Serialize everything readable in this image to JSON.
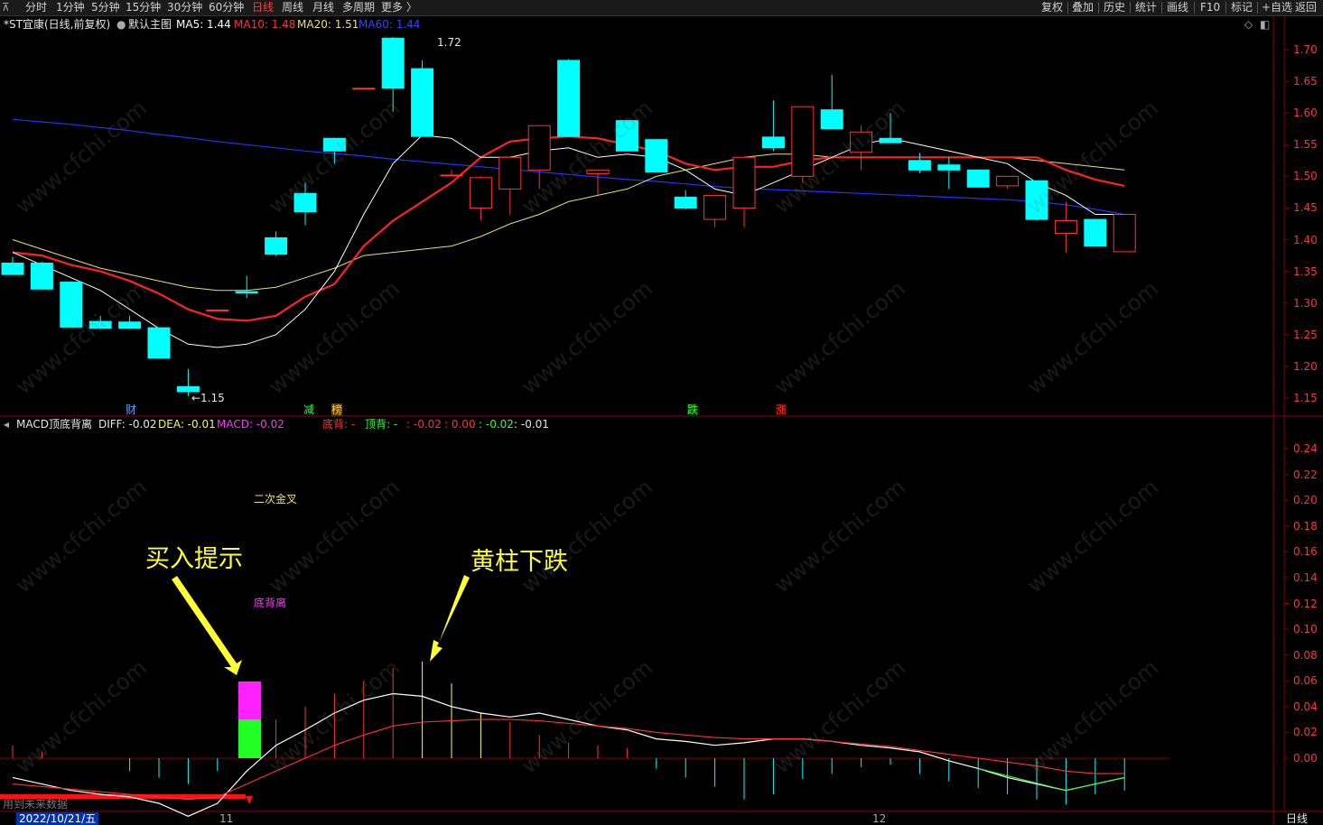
{
  "topbar": {
    "back_icon": "⊼",
    "periods": [
      "分时",
      "1分钟",
      "5分钟",
      "15分钟",
      "30分钟",
      "60分钟",
      "日线",
      "周线",
      "月线",
      "多周期",
      "更多 〉"
    ],
    "active_period": "日线",
    "right_buttons": [
      "复权",
      "叠加",
      "历史",
      "统计",
      "画线",
      "F10",
      "标记",
      "+自选",
      "返回"
    ]
  },
  "main_header": {
    "stock": "*ST宜康(日线,前复权)",
    "template": "默认主图",
    "ma5": "MA5: 1.44",
    "ma10": "MA10: 1.48",
    "ma20": "MA20: 1.51",
    "ma60": "MA60: 1.44",
    "diamond_icon": "◇",
    "more_icon": "◧"
  },
  "main_axis": [
    "1.70",
    "1.65",
    "1.60",
    "1.55",
    "1.50",
    "1.45",
    "1.40",
    "1.35",
    "1.30",
    "1.25",
    "1.20",
    "1.15"
  ],
  "main_notes": {
    "high": "1.72",
    "low": "←1.15",
    "flags": [
      "财",
      "减",
      "榜",
      "跌",
      "涨"
    ]
  },
  "macd_header": {
    "name": "MACD顶底背离",
    "diff": "DIFF: -0.02",
    "dea": "DEA: -0.01",
    "macd": "MACD: -0.02",
    "bottom_div": "底背: -",
    "top_div": "顶背: -",
    "v1": ": -0.02",
    "v2": ": 0.00",
    "v3": ": -0.02",
    "v4": ": -0.01"
  },
  "macd_axis": [
    "0.24",
    "0.22",
    "0.20",
    "0.18",
    "0.16",
    "0.14",
    "0.12",
    "0.10",
    "0.08",
    "0.06",
    "0.04",
    "0.02",
    "0.00"
  ],
  "annotations": {
    "golden_cross": "二次金叉",
    "buy_hint": "买入提示",
    "bottom_divergence": "底背离",
    "yellow_drop": "黄柱下跌"
  },
  "footer": {
    "future_data": "用到未来数据",
    "date": "2022/10/21/五",
    "month_11": "11",
    "month_12": "12",
    "period_tab": "日线"
  },
  "watermark": "www.cfchi.com",
  "colors": {
    "up": "#ff3333",
    "down": "#00ffff",
    "ma5": "#ffffff",
    "ma10": "#ff2222",
    "ma20": "#e8e070",
    "ma60": "#2233ff",
    "grid": "#8b0000"
  },
  "chart_data": {
    "type": "candlestick",
    "ohlc": [
      [
        1.363,
        1.373,
        1.353,
        1.345
      ],
      [
        1.363,
        1.365,
        1.33,
        1.322
      ],
      [
        1.333,
        1.334,
        1.285,
        1.262
      ],
      [
        1.271,
        1.28,
        1.26,
        1.26
      ],
      [
        1.27,
        1.28,
        1.262,
        1.26
      ],
      [
        1.261,
        1.261,
        1.213,
        1.213
      ],
      [
        1.168,
        1.196,
        1.153,
        1.16
      ],
      [
        1.289,
        1.29,
        1.289,
        1.289
      ],
      [
        1.318,
        1.343,
        1.308,
        1.316
      ],
      [
        1.403,
        1.413,
        1.374,
        1.377
      ],
      [
        1.473,
        1.49,
        1.423,
        1.444
      ],
      [
        1.56,
        1.561,
        1.52,
        1.54
      ],
      [
        1.639,
        1.64,
        1.639,
        1.639
      ],
      [
        1.718,
        1.72,
        1.602,
        1.639
      ],
      [
        1.67,
        1.683,
        1.563,
        1.563
      ],
      [
        1.502,
        1.51,
        1.502,
        1.502
      ],
      [
        1.45,
        1.5,
        1.43,
        1.498
      ],
      [
        1.48,
        1.53,
        1.44,
        1.53
      ],
      [
        1.51,
        1.58,
        1.48,
        1.58
      ],
      [
        1.683,
        1.685,
        1.563,
        1.563
      ],
      [
        1.504,
        1.51,
        1.471,
        1.51
      ],
      [
        1.588,
        1.588,
        1.543,
        1.54
      ],
      [
        1.558,
        1.558,
        1.51,
        1.507
      ],
      [
        1.467,
        1.478,
        1.448,
        1.45
      ],
      [
        1.432,
        1.47,
        1.42,
        1.47
      ],
      [
        1.45,
        1.53,
        1.42,
        1.53
      ],
      [
        1.562,
        1.62,
        1.54,
        1.545
      ],
      [
        1.5,
        1.61,
        1.49,
        1.61
      ],
      [
        1.605,
        1.66,
        1.575,
        1.575
      ],
      [
        1.538,
        1.58,
        1.51,
        1.57
      ],
      [
        1.56,
        1.6,
        1.553,
        1.553
      ],
      [
        1.525,
        1.537,
        1.505,
        1.51
      ],
      [
        1.518,
        1.53,
        1.48,
        1.51
      ],
      [
        1.51,
        1.51,
        1.483,
        1.483
      ],
      [
        1.485,
        1.5,
        1.48,
        1.5
      ],
      [
        1.493,
        1.493,
        1.43,
        1.432
      ],
      [
        1.41,
        1.46,
        1.38,
        1.43
      ],
      [
        1.432,
        1.432,
        1.39,
        1.39
      ],
      [
        1.381,
        1.44,
        1.381,
        1.44
      ]
    ],
    "ma5": [
      1.38,
      1.36,
      1.34,
      1.32,
      1.29,
      1.26,
      1.235,
      1.23,
      1.235,
      1.25,
      1.29,
      1.35,
      1.44,
      1.52,
      1.565,
      1.56,
      1.53,
      1.53,
      1.54,
      1.545,
      1.53,
      1.535,
      1.53,
      1.51,
      1.48,
      1.47,
      1.49,
      1.51,
      1.53,
      1.55,
      1.56,
      1.55,
      1.54,
      1.53,
      1.52,
      1.49,
      1.47,
      1.44,
      1.44
    ],
    "ma10": [
      1.38,
      1.375,
      1.36,
      1.35,
      1.335,
      1.315,
      1.29,
      1.275,
      1.272,
      1.28,
      1.31,
      1.33,
      1.39,
      1.43,
      1.46,
      1.49,
      1.53,
      1.555,
      1.56,
      1.563,
      1.56,
      1.55,
      1.54,
      1.52,
      1.51,
      1.515,
      1.515,
      1.525,
      1.53,
      1.53,
      1.53,
      1.53,
      1.53,
      1.53,
      1.53,
      1.53,
      1.51,
      1.495,
      1.485
    ],
    "ma20": [
      1.4,
      1.385,
      1.37,
      1.355,
      1.345,
      1.335,
      1.325,
      1.32,
      1.32,
      1.325,
      1.34,
      1.355,
      1.375,
      1.38,
      1.385,
      1.39,
      1.405,
      1.425,
      1.44,
      1.46,
      1.47,
      1.48,
      1.5,
      1.51,
      1.52,
      1.53,
      1.535,
      1.535,
      1.53,
      1.53,
      1.53,
      1.53,
      1.53,
      1.53,
      1.53,
      1.525,
      1.52,
      1.515,
      1.51
    ],
    "ma60": [
      1.59,
      1.586,
      1.582,
      1.577,
      1.572,
      1.566,
      1.561,
      1.555,
      1.55,
      1.545,
      1.54,
      1.536,
      1.532,
      1.527,
      1.523,
      1.519,
      1.515,
      1.511,
      1.507,
      1.503,
      1.499,
      1.495,
      1.492,
      1.488,
      1.484,
      1.481,
      1.479,
      1.477,
      1.475,
      1.473,
      1.471,
      1.469,
      1.467,
      1.465,
      1.463,
      1.46,
      1.455,
      1.448,
      1.44
    ],
    "macd_bars": [
      0.01,
      0.005,
      0.0,
      0.0,
      -0.01,
      -0.015,
      -0.02,
      -0.01,
      0.04,
      0.03,
      0.04,
      0.05,
      0.06,
      0.07,
      0.075,
      0.058,
      0.035,
      0.028,
      0.018,
      0.012,
      0.01,
      0.008,
      -0.008,
      -0.015,
      -0.022,
      -0.032,
      -0.028,
      -0.016,
      -0.012,
      -0.007,
      -0.005,
      -0.012,
      -0.018,
      -0.023,
      -0.028,
      -0.032,
      -0.036,
      -0.028,
      -0.025
    ],
    "diff": [
      -0.015,
      -0.02,
      -0.025,
      -0.028,
      -0.03,
      -0.035,
      -0.045,
      -0.035,
      -0.01,
      0.01,
      0.022,
      0.035,
      0.045,
      0.05,
      0.048,
      0.04,
      0.035,
      0.032,
      0.035,
      0.03,
      0.025,
      0.022,
      0.015,
      0.013,
      0.01,
      0.012,
      0.015,
      0.015,
      0.013,
      0.01,
      0.008,
      0.005,
      -0.002,
      -0.008,
      -0.015,
      -0.02,
      -0.025,
      -0.02,
      -0.015
    ],
    "dea": [
      -0.02,
      -0.022,
      -0.024,
      -0.026,
      -0.028,
      -0.03,
      -0.032,
      -0.03,
      -0.02,
      -0.01,
      0.0,
      0.01,
      0.018,
      0.025,
      0.028,
      0.029,
      0.03,
      0.03,
      0.029,
      0.027,
      0.025,
      0.023,
      0.02,
      0.018,
      0.016,
      0.015,
      0.015,
      0.015,
      0.013,
      0.011,
      0.009,
      0.006,
      0.003,
      0.0,
      -0.003,
      -0.006,
      -0.01,
      -0.012,
      -0.012
    ]
  }
}
